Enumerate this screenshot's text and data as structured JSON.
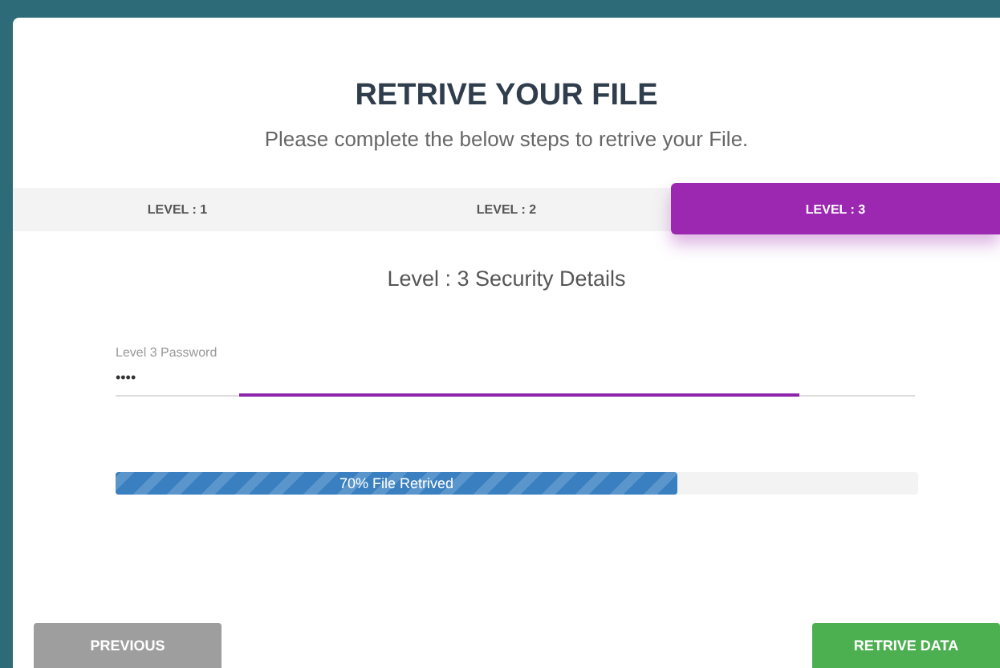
{
  "heading": "RETRIVE YOUR FILE",
  "subtitle": "Please complete the below steps to retrive your File.",
  "tabs": [
    {
      "label": "LEVEL : 1",
      "selected": false
    },
    {
      "label": "LEVEL : 2",
      "selected": false
    },
    {
      "label": "LEVEL : 3",
      "selected": true
    }
  ],
  "section_title": "Level : 3 Security Details",
  "password_field": {
    "label": "Level 3 Password",
    "value": "••••",
    "focused": true
  },
  "progress": {
    "level": 0.7,
    "label": "70% File Retrived"
  },
  "buttons": [
    {
      "label": "PREVIOUS",
      "kind": "secondary"
    },
    {
      "label": "RETRIVE DATA",
      "kind": "primary"
    }
  ]
}
